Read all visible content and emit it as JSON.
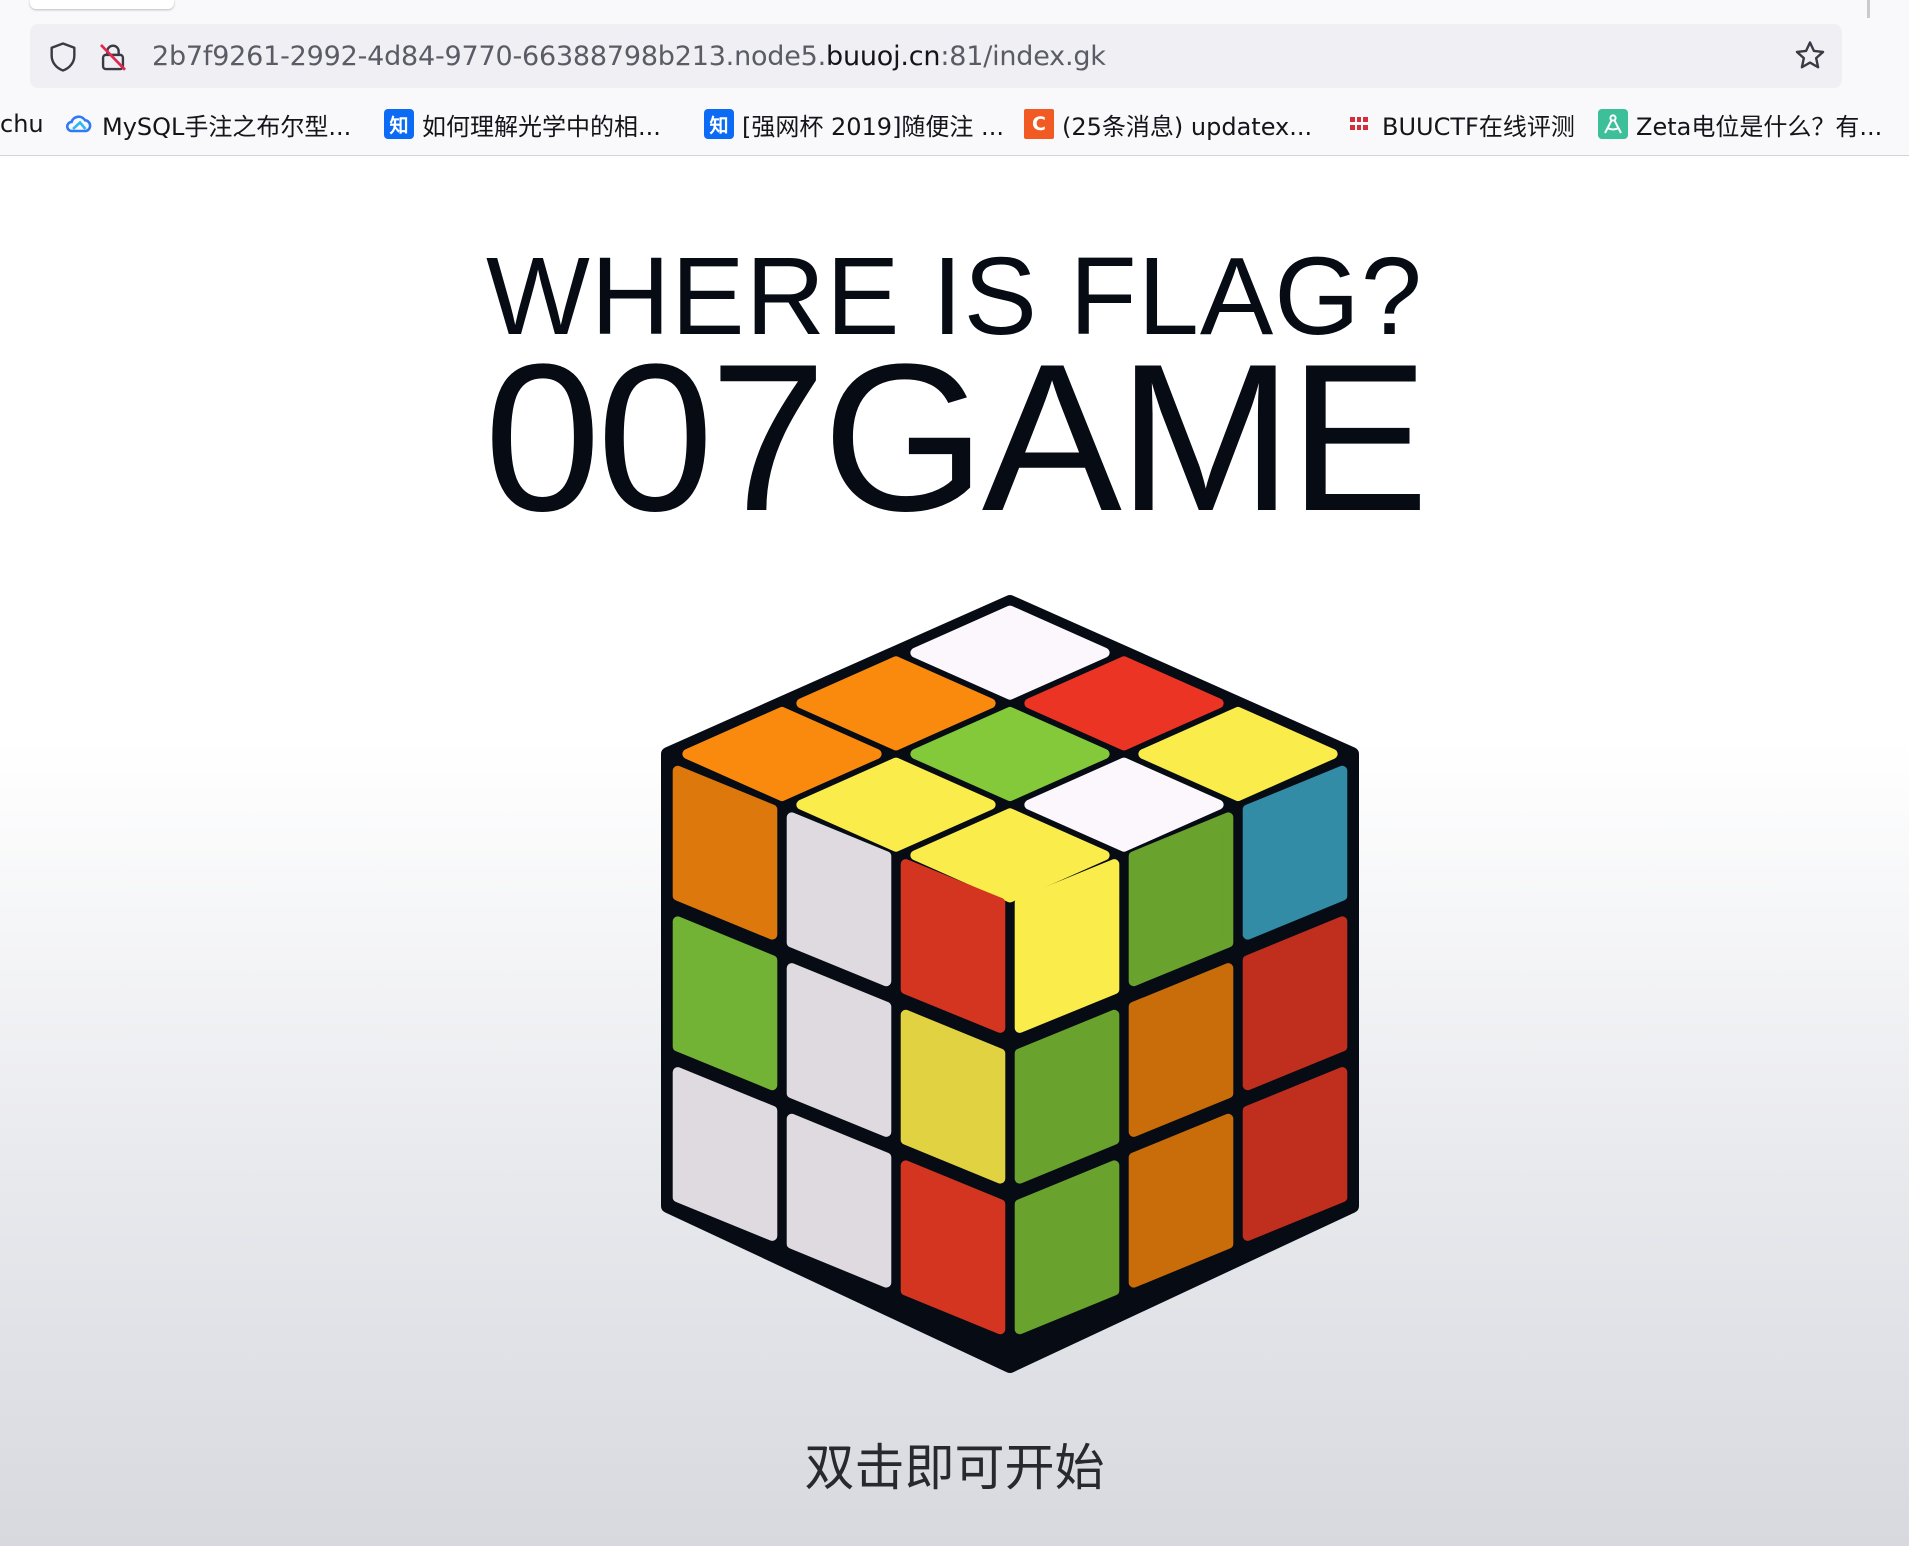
{
  "browser": {
    "url": {
      "prefix": "2b7f9261-2992-4d84-9770-66388798b213.node5.",
      "domain": "buuoj.cn",
      "suffix": ":81/index.gk"
    },
    "bookmarks": [
      {
        "label": "chu",
        "icon": "none"
      },
      {
        "label": "MySQL手注之布尔型...",
        "icon": "cloud-icon",
        "color": "#2f7bf6"
      },
      {
        "label": "如何理解光学中的相...",
        "icon": "zhihu-icon",
        "glyph": "知",
        "color": "#0b6bf5"
      },
      {
        "label": "[强网杯 2019]随便注 ...",
        "icon": "zhihu-icon",
        "glyph": "知",
        "color": "#0b6bf5"
      },
      {
        "label": "(25条消息) updatex...",
        "icon": "csdn-icon",
        "glyph": "C",
        "color": "#f25a24"
      },
      {
        "label": "BUUCTF在线评测",
        "icon": "buuctf-icon",
        "color": "#d22f3a"
      },
      {
        "label": "Zeta电位是什么？有...",
        "icon": "compass-icon",
        "color": "#3dbf9a"
      }
    ]
  },
  "page": {
    "headline": "WHERE IS FLAG?",
    "game_title": "007GAME",
    "start_hint": "双击即可开始"
  },
  "cube": {
    "body_color": "#060b14",
    "top_face": [
      [
        "#fbf7fd",
        "#fa8a0d",
        "#fa8a0d"
      ],
      [
        "#eb3424",
        "#84c93a",
        "#faec4a"
      ],
      [
        "#faec4a",
        "#fbf7fd",
        "#faec4a"
      ]
    ],
    "left_face": [
      [
        "#dd780c",
        "#dedae0",
        "#d33520"
      ],
      [
        "#72b234",
        "#dedae0",
        "#e0d240"
      ],
      [
        "#dedae0",
        "#dedae0",
        "#d33520"
      ]
    ],
    "right_face": [
      [
        "#faec4a",
        "#69a22c",
        "#338ca6"
      ],
      [
        "#69a22c",
        "#c96c0a",
        "#c02e1e"
      ],
      [
        "#69a22c",
        "#c96c0a",
        "#c02e1e"
      ]
    ],
    "right_face_lower": [
      [
        "#338ca6",
        "#c96c0a",
        "#c02e1e"
      ],
      [
        "#69a22c",
        "#c96c0a",
        "#c02e1e"
      ]
    ]
  }
}
